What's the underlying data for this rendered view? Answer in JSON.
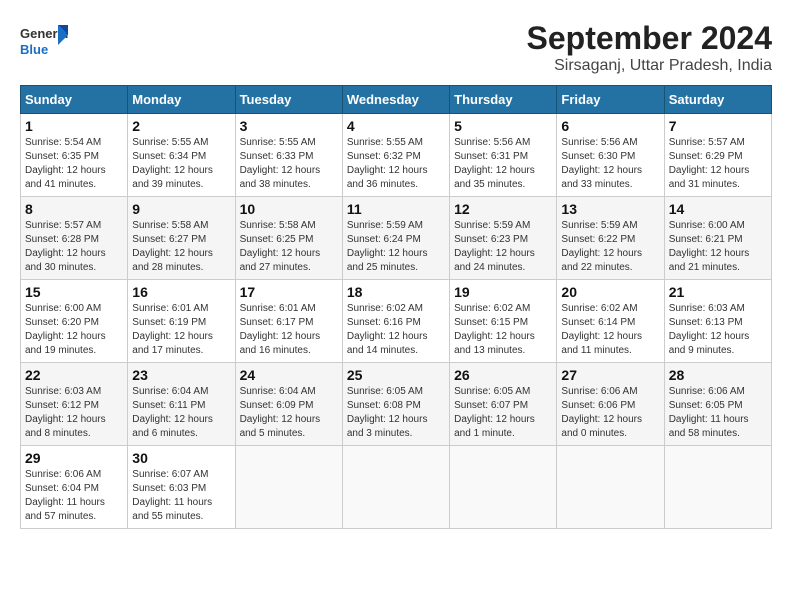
{
  "header": {
    "logo_general": "General",
    "logo_blue": "Blue",
    "month_title": "September 2024",
    "location": "Sirsaganj, Uttar Pradesh, India"
  },
  "calendar": {
    "days_of_week": [
      "Sunday",
      "Monday",
      "Tuesday",
      "Wednesday",
      "Thursday",
      "Friday",
      "Saturday"
    ],
    "weeks": [
      [
        {
          "day": "",
          "info": ""
        },
        {
          "day": "2",
          "info": "Sunrise: 5:55 AM\nSunset: 6:34 PM\nDaylight: 12 hours\nand 39 minutes."
        },
        {
          "day": "3",
          "info": "Sunrise: 5:55 AM\nSunset: 6:33 PM\nDaylight: 12 hours\nand 38 minutes."
        },
        {
          "day": "4",
          "info": "Sunrise: 5:55 AM\nSunset: 6:32 PM\nDaylight: 12 hours\nand 36 minutes."
        },
        {
          "day": "5",
          "info": "Sunrise: 5:56 AM\nSunset: 6:31 PM\nDaylight: 12 hours\nand 35 minutes."
        },
        {
          "day": "6",
          "info": "Sunrise: 5:56 AM\nSunset: 6:30 PM\nDaylight: 12 hours\nand 33 minutes."
        },
        {
          "day": "7",
          "info": "Sunrise: 5:57 AM\nSunset: 6:29 PM\nDaylight: 12 hours\nand 31 minutes."
        }
      ],
      [
        {
          "day": "1",
          "info": "Sunrise: 5:54 AM\nSunset: 6:35 PM\nDaylight: 12 hours\nand 41 minutes."
        },
        {
          "day": "",
          "info": ""
        },
        {
          "day": "",
          "info": ""
        },
        {
          "day": "",
          "info": ""
        },
        {
          "day": "",
          "info": ""
        },
        {
          "day": "",
          "info": ""
        },
        {
          "day": "",
          "info": ""
        }
      ],
      [
        {
          "day": "8",
          "info": "Sunrise: 5:57 AM\nSunset: 6:28 PM\nDaylight: 12 hours\nand 30 minutes."
        },
        {
          "day": "9",
          "info": "Sunrise: 5:58 AM\nSunset: 6:27 PM\nDaylight: 12 hours\nand 28 minutes."
        },
        {
          "day": "10",
          "info": "Sunrise: 5:58 AM\nSunset: 6:25 PM\nDaylight: 12 hours\nand 27 minutes."
        },
        {
          "day": "11",
          "info": "Sunrise: 5:59 AM\nSunset: 6:24 PM\nDaylight: 12 hours\nand 25 minutes."
        },
        {
          "day": "12",
          "info": "Sunrise: 5:59 AM\nSunset: 6:23 PM\nDaylight: 12 hours\nand 24 minutes."
        },
        {
          "day": "13",
          "info": "Sunrise: 5:59 AM\nSunset: 6:22 PM\nDaylight: 12 hours\nand 22 minutes."
        },
        {
          "day": "14",
          "info": "Sunrise: 6:00 AM\nSunset: 6:21 PM\nDaylight: 12 hours\nand 21 minutes."
        }
      ],
      [
        {
          "day": "15",
          "info": "Sunrise: 6:00 AM\nSunset: 6:20 PM\nDaylight: 12 hours\nand 19 minutes."
        },
        {
          "day": "16",
          "info": "Sunrise: 6:01 AM\nSunset: 6:19 PM\nDaylight: 12 hours\nand 17 minutes."
        },
        {
          "day": "17",
          "info": "Sunrise: 6:01 AM\nSunset: 6:17 PM\nDaylight: 12 hours\nand 16 minutes."
        },
        {
          "day": "18",
          "info": "Sunrise: 6:02 AM\nSunset: 6:16 PM\nDaylight: 12 hours\nand 14 minutes."
        },
        {
          "day": "19",
          "info": "Sunrise: 6:02 AM\nSunset: 6:15 PM\nDaylight: 12 hours\nand 13 minutes."
        },
        {
          "day": "20",
          "info": "Sunrise: 6:02 AM\nSunset: 6:14 PM\nDaylight: 12 hours\nand 11 minutes."
        },
        {
          "day": "21",
          "info": "Sunrise: 6:03 AM\nSunset: 6:13 PM\nDaylight: 12 hours\nand 9 minutes."
        }
      ],
      [
        {
          "day": "22",
          "info": "Sunrise: 6:03 AM\nSunset: 6:12 PM\nDaylight: 12 hours\nand 8 minutes."
        },
        {
          "day": "23",
          "info": "Sunrise: 6:04 AM\nSunset: 6:11 PM\nDaylight: 12 hours\nand 6 minutes."
        },
        {
          "day": "24",
          "info": "Sunrise: 6:04 AM\nSunset: 6:09 PM\nDaylight: 12 hours\nand 5 minutes."
        },
        {
          "day": "25",
          "info": "Sunrise: 6:05 AM\nSunset: 6:08 PM\nDaylight: 12 hours\nand 3 minutes."
        },
        {
          "day": "26",
          "info": "Sunrise: 6:05 AM\nSunset: 6:07 PM\nDaylight: 12 hours\nand 1 minute."
        },
        {
          "day": "27",
          "info": "Sunrise: 6:06 AM\nSunset: 6:06 PM\nDaylight: 12 hours\nand 0 minutes."
        },
        {
          "day": "28",
          "info": "Sunrise: 6:06 AM\nSunset: 6:05 PM\nDaylight: 11 hours\nand 58 minutes."
        }
      ],
      [
        {
          "day": "29",
          "info": "Sunrise: 6:06 AM\nSunset: 6:04 PM\nDaylight: 11 hours\nand 57 minutes."
        },
        {
          "day": "30",
          "info": "Sunrise: 6:07 AM\nSunset: 6:03 PM\nDaylight: 11 hours\nand 55 minutes."
        },
        {
          "day": "",
          "info": ""
        },
        {
          "day": "",
          "info": ""
        },
        {
          "day": "",
          "info": ""
        },
        {
          "day": "",
          "info": ""
        },
        {
          "day": "",
          "info": ""
        }
      ]
    ]
  }
}
